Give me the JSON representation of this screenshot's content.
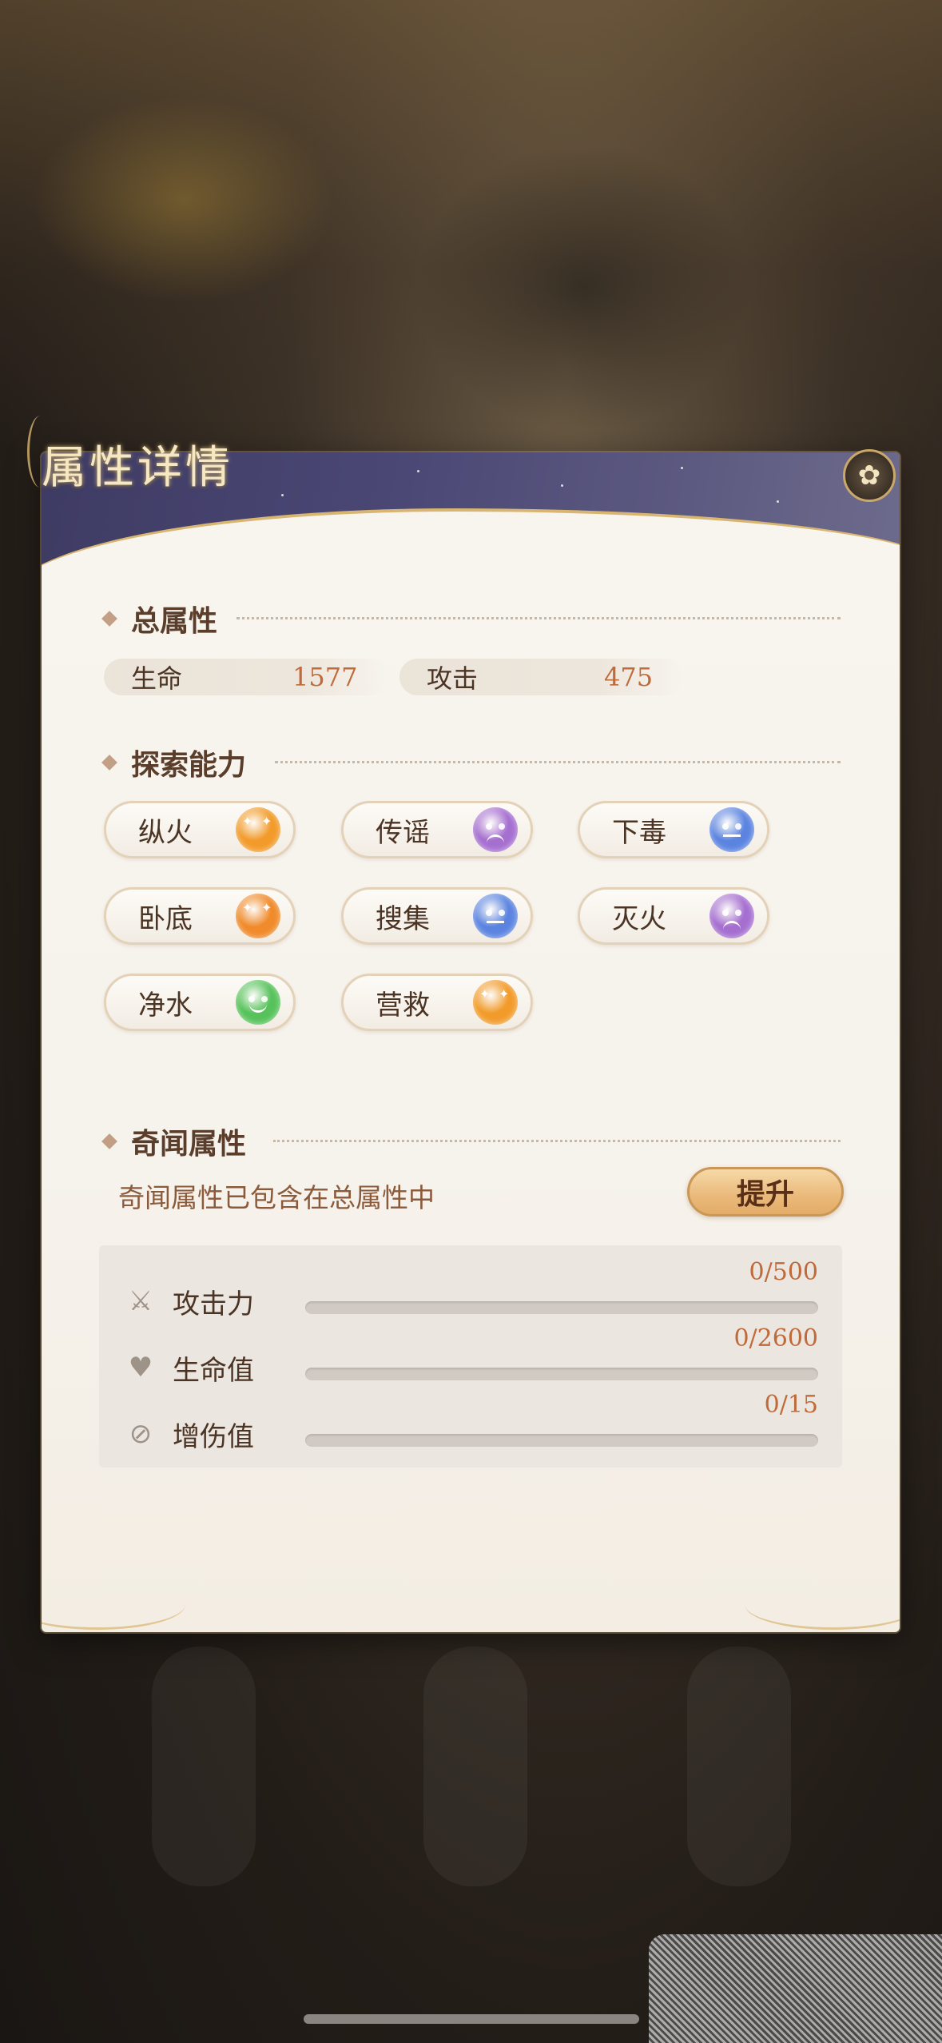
{
  "header": {
    "title": "属性详情",
    "close_icon": "close-flower-icon"
  },
  "total_attributes": {
    "title": "总属性",
    "stats": [
      {
        "name": "生命",
        "value": "1577"
      },
      {
        "name": "攻击",
        "value": "475"
      }
    ]
  },
  "exploration": {
    "title": "探索能力",
    "abilities": [
      {
        "name": "纵火",
        "mood": "star",
        "color": "#f29b2a"
      },
      {
        "name": "传谣",
        "mood": "sad",
        "color": "#a56fd0"
      },
      {
        "name": "下毒",
        "mood": "neutral",
        "color": "#5b84e0"
      },
      {
        "name": "卧底",
        "mood": "star",
        "color": "#f08a2a"
      },
      {
        "name": "搜集",
        "mood": "neutral",
        "color": "#5b84e0"
      },
      {
        "name": "灭火",
        "mood": "sad",
        "color": "#a56fd0"
      },
      {
        "name": "净水",
        "mood": "happy",
        "color": "#56c25a"
      },
      {
        "name": "营救",
        "mood": "star",
        "color": "#f29b2a"
      }
    ]
  },
  "rumor_attributes": {
    "title": "奇闻属性",
    "note": "奇闻属性已包含在总属性中",
    "upgrade_label": "提升",
    "bonuses": [
      {
        "label": "攻击力",
        "value": "0/500",
        "progress": 0,
        "icon": "sword-icon"
      },
      {
        "label": "生命值",
        "value": "0/2600",
        "progress": 0,
        "icon": "heart-plus-icon"
      },
      {
        "label": "增伤值",
        "value": "0/15",
        "progress": 0,
        "icon": "damage-boost-icon"
      }
    ]
  },
  "colors": {
    "accent": "#c06a3a",
    "header": "#4a4775",
    "gold": "#d8b672"
  }
}
